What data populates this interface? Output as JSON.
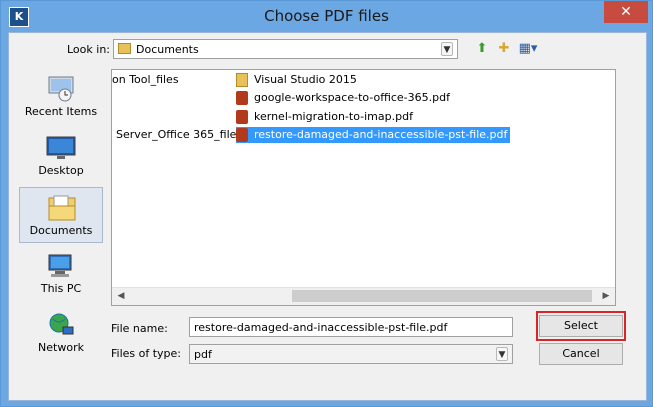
{
  "window": {
    "title": "Choose PDF files",
    "app_icon_letter": "K",
    "close_glyph": "✕"
  },
  "toolbar": {
    "look_in_label": "Look in:",
    "look_in_value": "Documents"
  },
  "places": [
    {
      "label": "Recent Items",
      "icon": "recent-items-icon"
    },
    {
      "label": "Desktop",
      "icon": "desktop-icon"
    },
    {
      "label": "Documents",
      "icon": "documents-icon",
      "selected": true
    },
    {
      "label": "This PC",
      "icon": "this-pc-icon"
    },
    {
      "label": "Network",
      "icon": "network-icon"
    }
  ],
  "files": {
    "col1": [
      "on Tool_files",
      "Server_Office 365_files"
    ],
    "col2": [
      {
        "name": "Visual Studio 2015",
        "type": "folder"
      },
      {
        "name": "google-workspace-to-office-365.pdf",
        "type": "pdf"
      },
      {
        "name": "kernel-migration-to-imap.pdf",
        "type": "pdf"
      },
      {
        "name": "restore-damaged-and-inaccessible-pst-file.pdf",
        "type": "pdf",
        "selected": true
      }
    ]
  },
  "file_name": {
    "label": "File name:",
    "value": "restore-damaged-and-inaccessible-pst-file.pdf"
  },
  "file_type": {
    "label": "Files of type:",
    "value": "pdf"
  },
  "buttons": {
    "select": "Select",
    "cancel": "Cancel"
  },
  "colors": {
    "titlebar": "#6aa7e3",
    "selection": "#3399ff",
    "highlight_border": "#d9252a"
  }
}
